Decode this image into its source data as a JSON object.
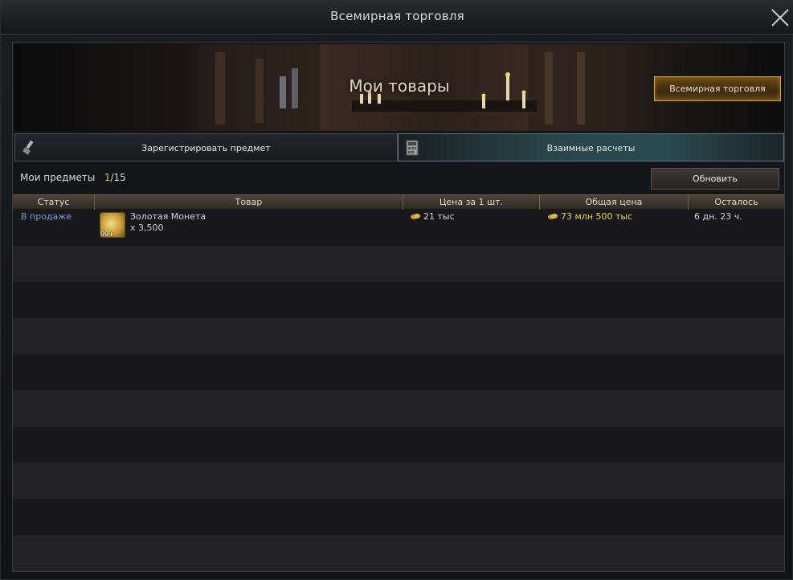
{
  "window": {
    "title": "Всемирная торговля"
  },
  "banner": {
    "title": "Мои товары",
    "world_trade_button": "Всемирная торговля"
  },
  "tabs": {
    "register": "Зарегистрировать предмет",
    "settlement": "Взаимные расчеты"
  },
  "items_bar": {
    "label": "Мои предметы",
    "count": "1",
    "max": "/15",
    "refresh": "Обновить"
  },
  "table": {
    "headers": [
      "Статус",
      "Товар",
      "Цена за 1 шт.",
      "Общая цена",
      "Осталось"
    ],
    "rows": [
      {
        "status": "В продаже",
        "item_name": "Золотая Монета",
        "quantity": "x 3,500",
        "badge": "99+",
        "unit_price": "21 тыс",
        "total_price": "73 млн 500 тыс",
        "remaining": "6 дн. 23 ч."
      }
    ]
  },
  "colors": {
    "status_on_sale": "#6f9ed8",
    "total_price": "#e8d94a",
    "count_current": "#e8c24a"
  },
  "icons": [
    "close-icon",
    "brush-icon",
    "calculator-icon",
    "gold-coin-icon",
    "coin-icon"
  ]
}
